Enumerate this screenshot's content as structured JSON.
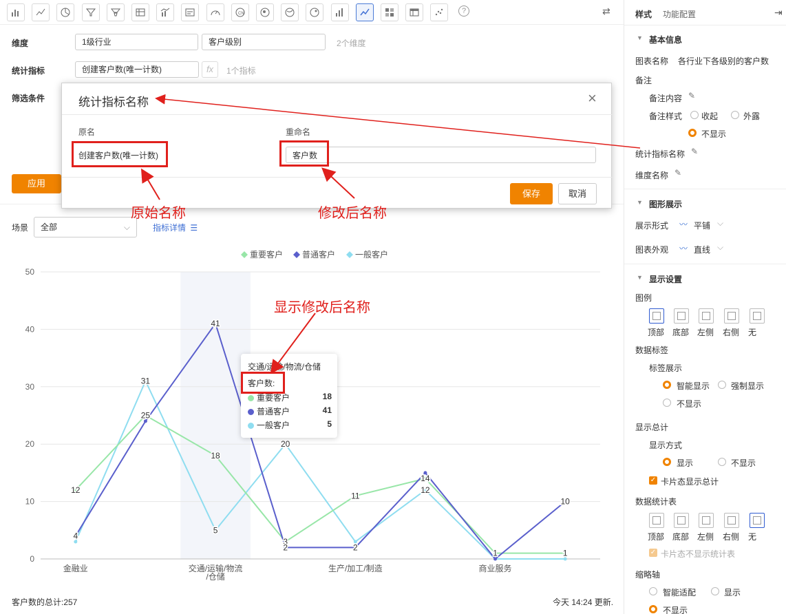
{
  "toolbar": {
    "icons": [
      "bar-chart",
      "line-chart",
      "pie-chart",
      "funnel",
      "funnel-alt",
      "table",
      "combo-chart",
      "card",
      "gauge",
      "map-cn",
      "map-region",
      "map-world",
      "map-alt",
      "bar-small",
      "line-chart-active",
      "heatmap",
      "cross-table",
      "scatter"
    ],
    "help": "?"
  },
  "config": {
    "dimension_label": "维度",
    "dimension_values": [
      "1级行业",
      "客户级别"
    ],
    "dimension_hint": "2个维度",
    "metric_label": "统计指标",
    "metric_value": "创建客户数(唯一计数)",
    "fx": "fx",
    "metric_hint": "1个指标",
    "filter_label": "筛选条件",
    "apply": "应用"
  },
  "modal": {
    "title": "统计指标名称",
    "col_original": "原名",
    "col_rename": "重命名",
    "original_value": "创建客户数(唯一计数)",
    "rename_value": "客户数",
    "save": "保存",
    "cancel": "取消"
  },
  "annotations": {
    "original": "原始名称",
    "renamed": "修改后名称",
    "display": "显示修改后名称"
  },
  "scene": {
    "label": "场景",
    "value": "全部",
    "detail_link": "指标详情"
  },
  "tooltip": {
    "title": "交通/运输/物流/仓储",
    "metric": "客户数:",
    "rows": [
      {
        "name": "重要客户",
        "value": "18"
      },
      {
        "name": "普通客户",
        "value": "41"
      },
      {
        "name": "一般客户",
        "value": "5"
      }
    ]
  },
  "footer": {
    "total": "客户数的总计:257",
    "updated": "今天 14:24 更新."
  },
  "chart_data": {
    "type": "line",
    "categories": [
      "金融业",
      "",
      "交通/运输/物流/仓储",
      "",
      "生产/加工/制造",
      "",
      "商业服务",
      ""
    ],
    "x_tick_labels": [
      "金融业",
      "交通/运输/物流",
      "/仓储",
      "生产/加工/制造",
      "商业服务"
    ],
    "ylim": [
      0,
      50
    ],
    "yticks": [
      0,
      10,
      20,
      30,
      40,
      50
    ],
    "legend_position": "top",
    "highlighted_category_index": 2,
    "series": [
      {
        "name": "重要客户",
        "color": "#98e6a8",
        "values": [
          12,
          25,
          18,
          3,
          11,
          14,
          1,
          1
        ]
      },
      {
        "name": "普通客户",
        "color": "#5a5fcc",
        "values": [
          4,
          24,
          41,
          2,
          2,
          15,
          0,
          10
        ]
      },
      {
        "name": "一般客户",
        "color": "#8fddf0",
        "values": [
          3,
          31,
          5,
          20,
          3,
          12,
          0,
          0
        ]
      }
    ],
    "labels": [
      {
        "series": 0,
        "values": [
          "12",
          "25",
          "18",
          "3",
          "11",
          "14",
          "1",
          "1"
        ]
      },
      {
        "series": 1,
        "values": [
          "4",
          "",
          "41",
          "2",
          "2",
          "",
          "",
          "10"
        ]
      },
      {
        "series": 2,
        "values": [
          "",
          "31",
          "5",
          "20",
          "",
          "12",
          "",
          ""
        ]
      }
    ]
  },
  "right_panel": {
    "tabs": [
      "样式",
      "功能配置"
    ],
    "basic": {
      "section": "基本信息",
      "chart_name_label": "图表名称",
      "chart_name_value": "各行业下各级别的客户数",
      "remark": "备注",
      "remark_content": "备注内容",
      "remark_style": "备注样式",
      "remark_options": [
        "收起",
        "外露",
        "不显示"
      ],
      "metric_name": "统计指标名称",
      "dimension_name": "维度名称"
    },
    "graphic": {
      "section": "图形展示",
      "form_label": "展示形式",
      "form_value": "平铺",
      "look_label": "图表外观",
      "look_value": "直线"
    },
    "display": {
      "section": "显示设置",
      "legend": "图例",
      "legend_positions": [
        "顶部",
        "底部",
        "左侧",
        "右侧",
        "无"
      ],
      "data_label": "数据标签",
      "label_show": "标签展示",
      "label_options": [
        "智能显示",
        "强制显示",
        "不显示"
      ],
      "show_total": "显示总计",
      "show_mode": "显示方式",
      "show_options": [
        "显示",
        "不显示"
      ],
      "card_total": "卡片态显示总计",
      "stat_table": "数据统计表",
      "stat_positions": [
        "顶部",
        "底部",
        "左侧",
        "右侧",
        "无"
      ],
      "card_no_stat": "卡片态不显示统计表",
      "zoom_axis": "缩略轴",
      "zoom_options": [
        "智能适配",
        "显示",
        "不显示"
      ]
    }
  }
}
